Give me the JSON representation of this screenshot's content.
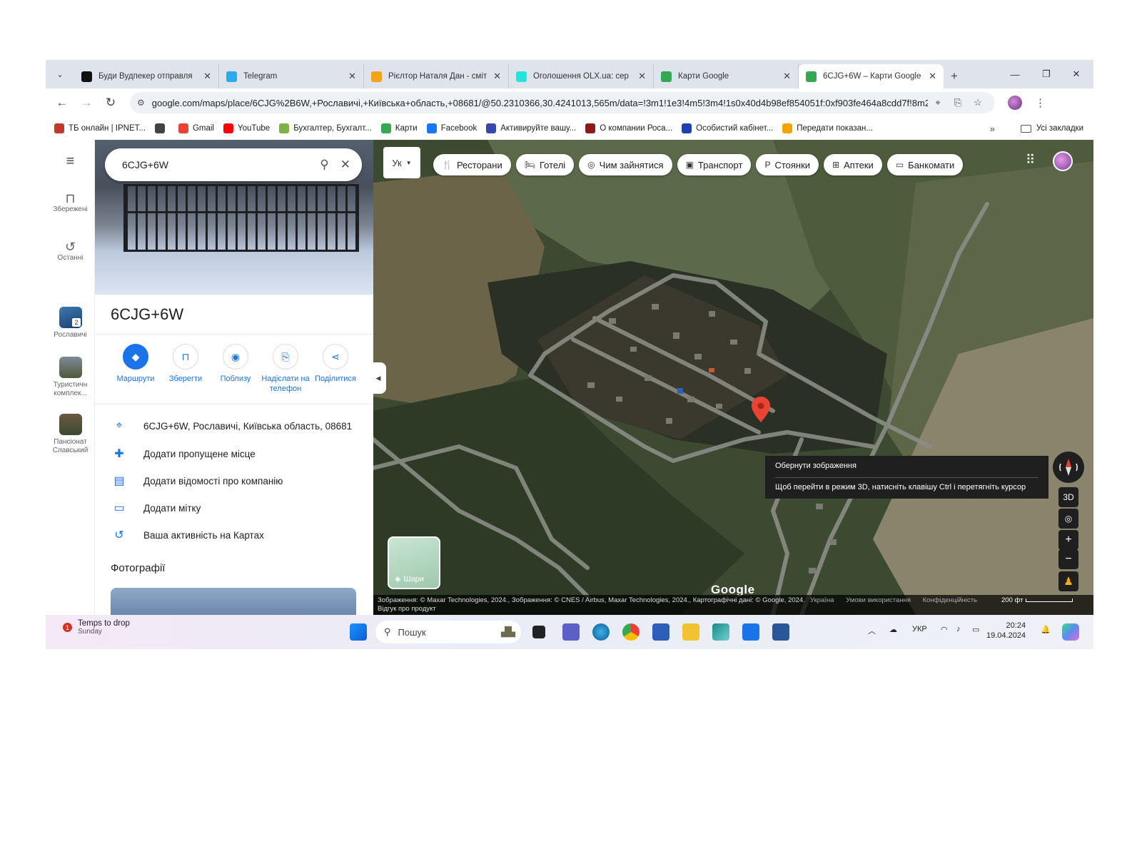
{
  "browser": {
    "tabs": [
      {
        "title": "Буди Вудпекер отправля",
        "icon": "k-icon",
        "color": "#111111"
      },
      {
        "title": "Telegram",
        "icon": "telegram-icon",
        "color": "#2aabee"
      },
      {
        "title": "Рієлтор Наталя Дан - сміт",
        "icon": "d-icon",
        "color": "#f2a31c"
      },
      {
        "title": "Оголошення OLX.ua: сер",
        "icon": "olx-icon",
        "color": "#23e5db"
      },
      {
        "title": "Карти Google",
        "icon": "maps-pin-icon",
        "color": "#34a853"
      },
      {
        "title": "6CJG+6W – Карти Google",
        "icon": "maps-pin-icon",
        "color": "#34a853",
        "active": true
      }
    ],
    "new_tab": "+",
    "url": "google.com/maps/place/6CJG%2B6W,+Рославичі,+Київська+область,+08681/@50.2310366,30.4241013,565m/data=!3m1!1e3!4m5!3m4!1s0x40d4b98ef854051f:0xf903fe464a8cdd7f!8m2!3d...",
    "bookmarks": [
      {
        "label": "ТБ онлайн | IPNET...",
        "color": "#c0392b"
      },
      {
        "label": "",
        "color": "#444444"
      },
      {
        "label": "Gmail",
        "color": "#ea4335"
      },
      {
        "label": "YouTube",
        "color": "#ff0000"
      },
      {
        "label": "Бухгалтер, Бухгалт...",
        "color": "#7cb342"
      },
      {
        "label": "Карти",
        "color": "#34a853"
      },
      {
        "label": "Facebook",
        "color": "#1877f2"
      },
      {
        "label": "Активируйте вашу...",
        "color": "#3949ab"
      },
      {
        "label": "О компании Роса...",
        "color": "#8b1a1a"
      },
      {
        "label": "Особистий кабінет...",
        "color": "#1e40af"
      },
      {
        "label": "Передати показан...",
        "color": "#f4a300"
      }
    ],
    "bookmarks_more": "»",
    "all_bookmarks": "Усі закладки"
  },
  "rail": {
    "menu_icon": "≡",
    "saved": "Збережені",
    "recent": "Останні",
    "recents": [
      {
        "label": "Рославичі",
        "badge": "2"
      },
      {
        "label": "Туристичн комплек..."
      },
      {
        "label": "Пансіонат Слав­ський"
      }
    ]
  },
  "panel": {
    "search_value": "6CJG+6W",
    "title": "6CJG+6W",
    "actions": [
      {
        "label": "Маршрути",
        "icon": "directions-icon"
      },
      {
        "label": "Зберегти",
        "icon": "bookmark-icon"
      },
      {
        "label": "Поблизу",
        "icon": "nearby-icon"
      },
      {
        "label": "Надіслати на телефон",
        "icon": "send-to-phone-icon"
      },
      {
        "label": "Поділитися",
        "icon": "share-icon"
      }
    ],
    "info": [
      {
        "text": "6CJG+6W, Рославичі, Київська область, 08681",
        "icon": "location-pin-icon"
      },
      {
        "text": "Додати пропущене місце",
        "icon": "add-place-icon"
      },
      {
        "text": "Додати відомості про компанію",
        "icon": "add-business-icon"
      },
      {
        "text": "Додати мітку",
        "icon": "label-icon"
      },
      {
        "text": "Ваша активність на Картах",
        "icon": "history-icon"
      }
    ],
    "photos_heading": "Фотографії"
  },
  "map": {
    "lang": "Ук",
    "chips": [
      {
        "label": "Ресторани",
        "icon": "restaurant-icon",
        "glyph": "🍴"
      },
      {
        "label": "Готелі",
        "icon": "hotel-icon",
        "glyph": "🛏"
      },
      {
        "label": "Чим зайнятися",
        "icon": "camera-icon",
        "glyph": "◎"
      },
      {
        "label": "Транспорт",
        "icon": "transit-icon",
        "glyph": "▣"
      },
      {
        "label": "Стоянки",
        "icon": "parking-icon",
        "glyph": "P"
      },
      {
        "label": "Аптеки",
        "icon": "pharmacy-icon",
        "glyph": "⊞"
      },
      {
        "label": "Банкомати",
        "icon": "atm-icon",
        "glyph": "▭"
      }
    ],
    "tooltip_title": "Обернути зображення",
    "tooltip_text": "Щоб перейти в режим 3D, натисніть клавішу Ctrl і перетягніть курсор",
    "btn_3d": "3D",
    "zoom_in": "+",
    "zoom_out": "−",
    "layers_label": "Шари",
    "google_logo": "Google",
    "attribution": "Зображення: © Maxar Technologies, 2024., Зображення: © CNES / Airbus, Maxar Technologies, 2024., Картографічні дані: © Google, 2024.",
    "attribution_line2": "Відгук про продукт",
    "links": [
      "Україна",
      "Умови використання",
      "Конфіденційність"
    ],
    "scale": "200 фт"
  },
  "taskbar": {
    "notification_badge": "1",
    "weather_title": "Temps to drop",
    "weather_sub": "Sunday",
    "search_placeholder": "Пошук",
    "lang": "УКР",
    "time": "20:24",
    "date": "19.04.2024"
  }
}
